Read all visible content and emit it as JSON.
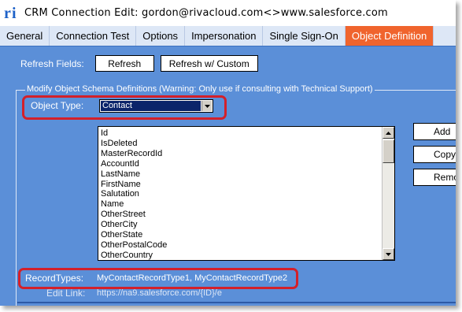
{
  "window": {
    "title": "CRM  Connection  Edit:  gordon@rivacloud.com<>www.salesforce.com",
    "logo_text": "ri"
  },
  "tabs": [
    {
      "label": "General",
      "active": false
    },
    {
      "label": "Connection Test",
      "active": false
    },
    {
      "label": "Options",
      "active": false
    },
    {
      "label": "Impersonation",
      "active": false
    },
    {
      "label": "Single Sign-On",
      "active": false
    },
    {
      "label": "Object Definition",
      "active": true
    }
  ],
  "refresh": {
    "label": "Refresh Fields:",
    "refresh_button": "Refresh",
    "refresh_custom_button": "Refresh w/ Custom"
  },
  "schema": {
    "group_label": "Modify Object Schema Definitions (Warning: Only use if consulting with Technical Support)",
    "object_type_label": "Object Type:",
    "object_type_value": "Contact",
    "fields": [
      "Id",
      "IsDeleted",
      "MasterRecordId",
      "AccountId",
      "LastName",
      "FirstName",
      "Salutation",
      "Name",
      "OtherStreet",
      "OtherCity",
      "OtherState",
      "OtherPostalCode",
      "OtherCountry"
    ],
    "add_button": "Add",
    "copy_button": "Copy",
    "remove_button": "Remov"
  },
  "record_types": {
    "label": "RecordTypes:",
    "value": "MyContactRecordType1, MyContactRecordType2"
  },
  "edit_link": {
    "label": "Edit Link:",
    "value": "https://na9.salesforce.com/{ID}/e"
  },
  "colors": {
    "background": "#5b8fd8",
    "active_tab": "#f0642d",
    "highlight": "#d3202a",
    "selection": "#0b246a"
  }
}
